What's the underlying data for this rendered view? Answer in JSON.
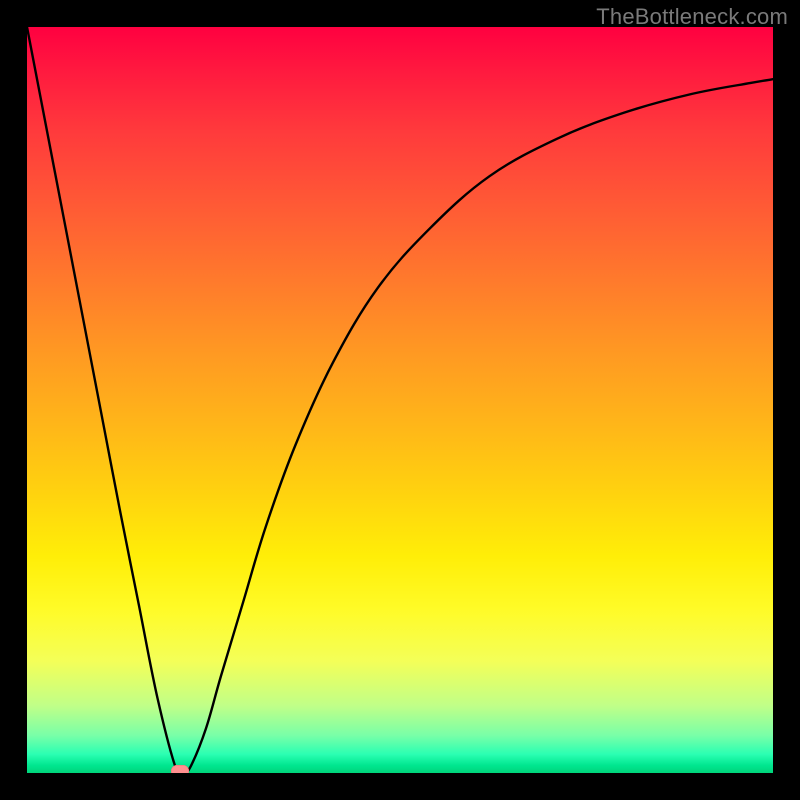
{
  "watermark": "TheBottleneck.com",
  "chart_data": {
    "type": "line",
    "title": "",
    "xlabel": "",
    "ylabel": "",
    "xlim": [
      0,
      100
    ],
    "ylim": [
      0,
      100
    ],
    "grid": false,
    "legend": false,
    "background": "gradient red-yellow-green (top to bottom)",
    "series": [
      {
        "name": "bottleneck-curve",
        "color": "#000000",
        "x": [
          0.0,
          2.5,
          5.0,
          7.5,
          10.0,
          12.5,
          15.0,
          17.5,
          20.0,
          21.0,
          22.0,
          24.0,
          26.0,
          29.0,
          32.0,
          36.0,
          41.0,
          47.0,
          54.0,
          62.0,
          71.0,
          80.0,
          89.0,
          97.0,
          100.0
        ],
        "y": [
          100.0,
          87.0,
          74.0,
          61.0,
          48.0,
          35.0,
          22.5,
          10.0,
          0.5,
          0.0,
          1.0,
          6.0,
          13.0,
          23.0,
          33.0,
          44.0,
          55.0,
          65.0,
          73.0,
          80.0,
          85.0,
          88.5,
          91.0,
          92.5,
          93.0
        ]
      }
    ],
    "annotations": [
      {
        "name": "marker",
        "shape": "pill",
        "color": "#ff8f8f",
        "x": 20.5,
        "y": 0.3
      }
    ]
  }
}
